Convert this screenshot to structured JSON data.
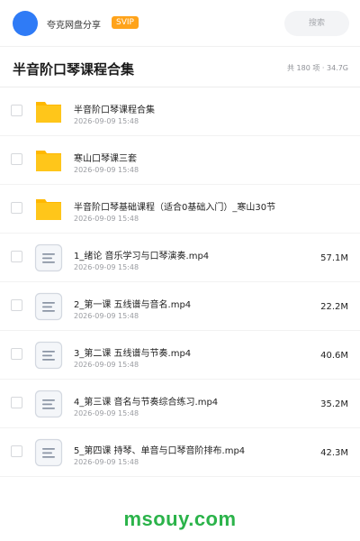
{
  "header": {
    "owner_name": "夸克网盘分享",
    "badge": "SVIP",
    "search_placeholder": "搜索"
  },
  "title_bar": {
    "title": "半音阶口琴课程合集",
    "meta": "共 180 项 · 34.7G"
  },
  "colors": {
    "avatar": "#2f7bf6",
    "badge": "#ffa31a",
    "folder": "#ffc61a",
    "watermark": "#2bb34a"
  },
  "items": [
    {
      "type": "folder",
      "icon": "folder-icon",
      "name": "半音阶口琴课程合集",
      "date": "2026-09-09 15:48",
      "size": ""
    },
    {
      "type": "folder",
      "icon": "folder-icon",
      "name": "寒山口琴课三套",
      "date": "2026-09-09 15:48",
      "size": ""
    },
    {
      "type": "folder",
      "icon": "folder-icon",
      "name": "半音阶口琴基础课程（适合0基础入门）_寒山30节",
      "date": "2026-09-09 15:48",
      "size": ""
    },
    {
      "type": "file",
      "icon": "video-file-icon",
      "name": "1_绪论 音乐学习与口琴演奏.mp4",
      "date": "2026-09-09 15:48",
      "size": "57.1M"
    },
    {
      "type": "file",
      "icon": "video-file-icon",
      "name": "2_第一课 五线谱与音名.mp4",
      "date": "2026-09-09 15:48",
      "size": "22.2M"
    },
    {
      "type": "file",
      "icon": "video-file-icon",
      "name": "3_第二课 五线谱与节奏.mp4",
      "date": "2026-09-09 15:48",
      "size": "40.6M"
    },
    {
      "type": "file",
      "icon": "video-file-icon",
      "name": "4_第三课 音名与节奏综合练习.mp4",
      "date": "2026-09-09 15:48",
      "size": "35.2M"
    },
    {
      "type": "file",
      "icon": "video-file-icon",
      "name": "5_第四课 持琴、单音与口琴音阶排布.mp4",
      "date": "2026-09-09 15:48",
      "size": "42.3M"
    }
  ],
  "watermark": "msouy.com"
}
